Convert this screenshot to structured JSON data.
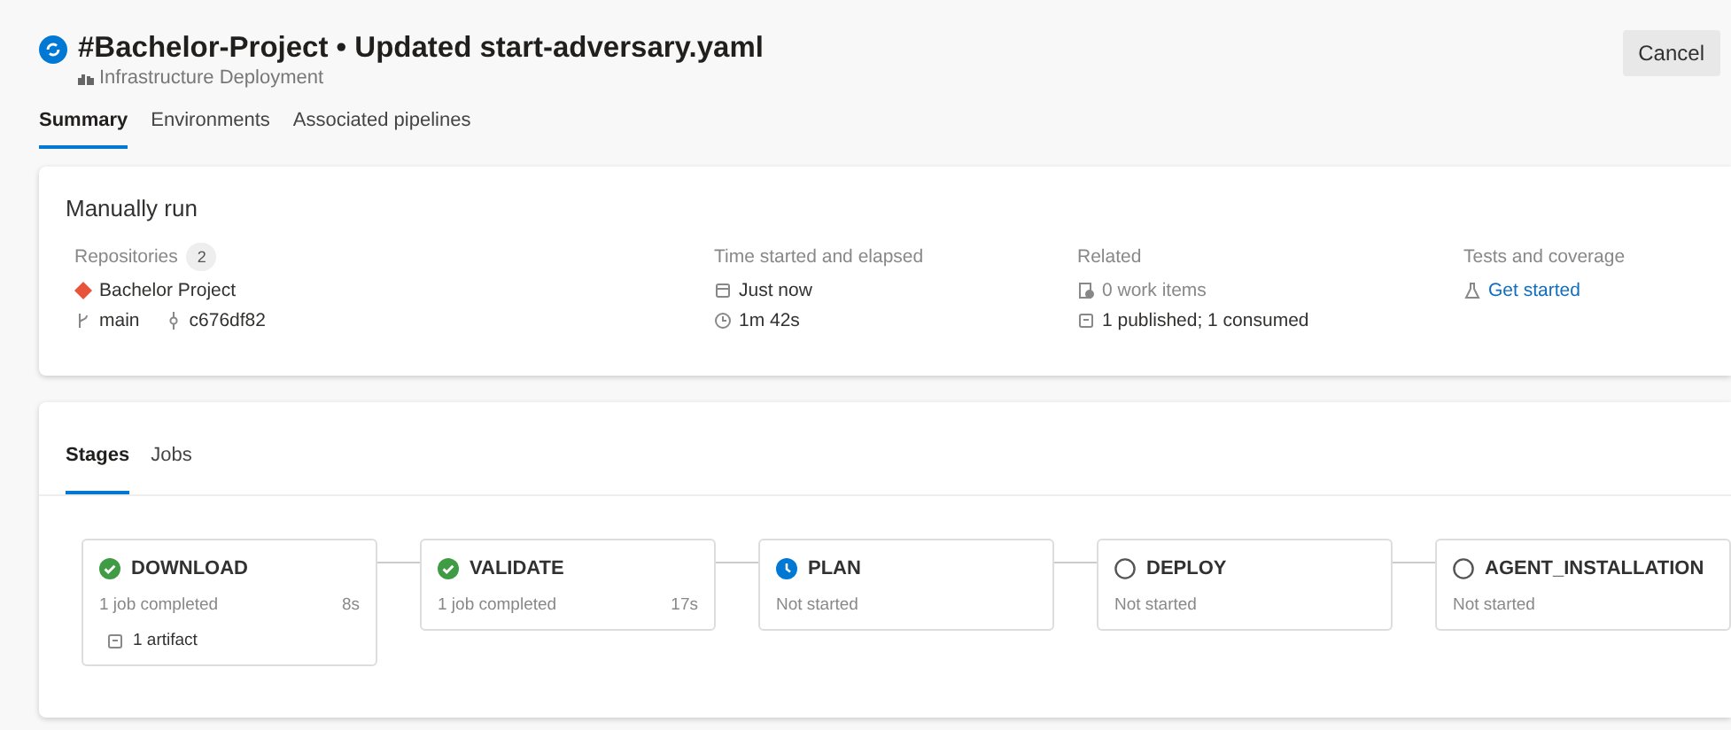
{
  "header": {
    "title": "#Bachelor-Project • Updated start-adversary.yaml",
    "subtitle": "Infrastructure Deployment",
    "cancel": "Cancel"
  },
  "tabs": [
    {
      "label": "Summary",
      "selected": true
    },
    {
      "label": "Environments",
      "selected": false
    },
    {
      "label": "Associated pipelines",
      "selected": false
    }
  ],
  "summary": {
    "title": "Manually run",
    "repositories": {
      "label": "Repositories",
      "count": "2",
      "name": "Bachelor Project",
      "branch": "main",
      "commit": "c676df82"
    },
    "time": {
      "label": "Time started and elapsed",
      "started": "Just now",
      "elapsed": "1m 42s"
    },
    "related": {
      "label": "Related",
      "work_items": "0 work items",
      "artifacts": "1 published; 1 consumed"
    },
    "tests": {
      "label": "Tests and coverage",
      "link": "Get started"
    }
  },
  "stage_tabs": [
    {
      "label": "Stages",
      "selected": true
    },
    {
      "label": "Jobs",
      "selected": false
    }
  ],
  "stages": [
    {
      "name": "DOWNLOAD",
      "kind": "succeeded",
      "detail": "1 job completed",
      "duration": "8s",
      "artifact": "1 artifact"
    },
    {
      "name": "VALIDATE",
      "kind": "succeeded",
      "detail": "1 job completed",
      "duration": "17s"
    },
    {
      "name": "PLAN",
      "kind": "waiting",
      "detail": "Not started"
    },
    {
      "name": "DEPLOY",
      "kind": "notstarted",
      "detail": "Not started"
    },
    {
      "name": "AGENT_INSTALLATION",
      "kind": "notstarted",
      "detail": "Not started"
    }
  ]
}
